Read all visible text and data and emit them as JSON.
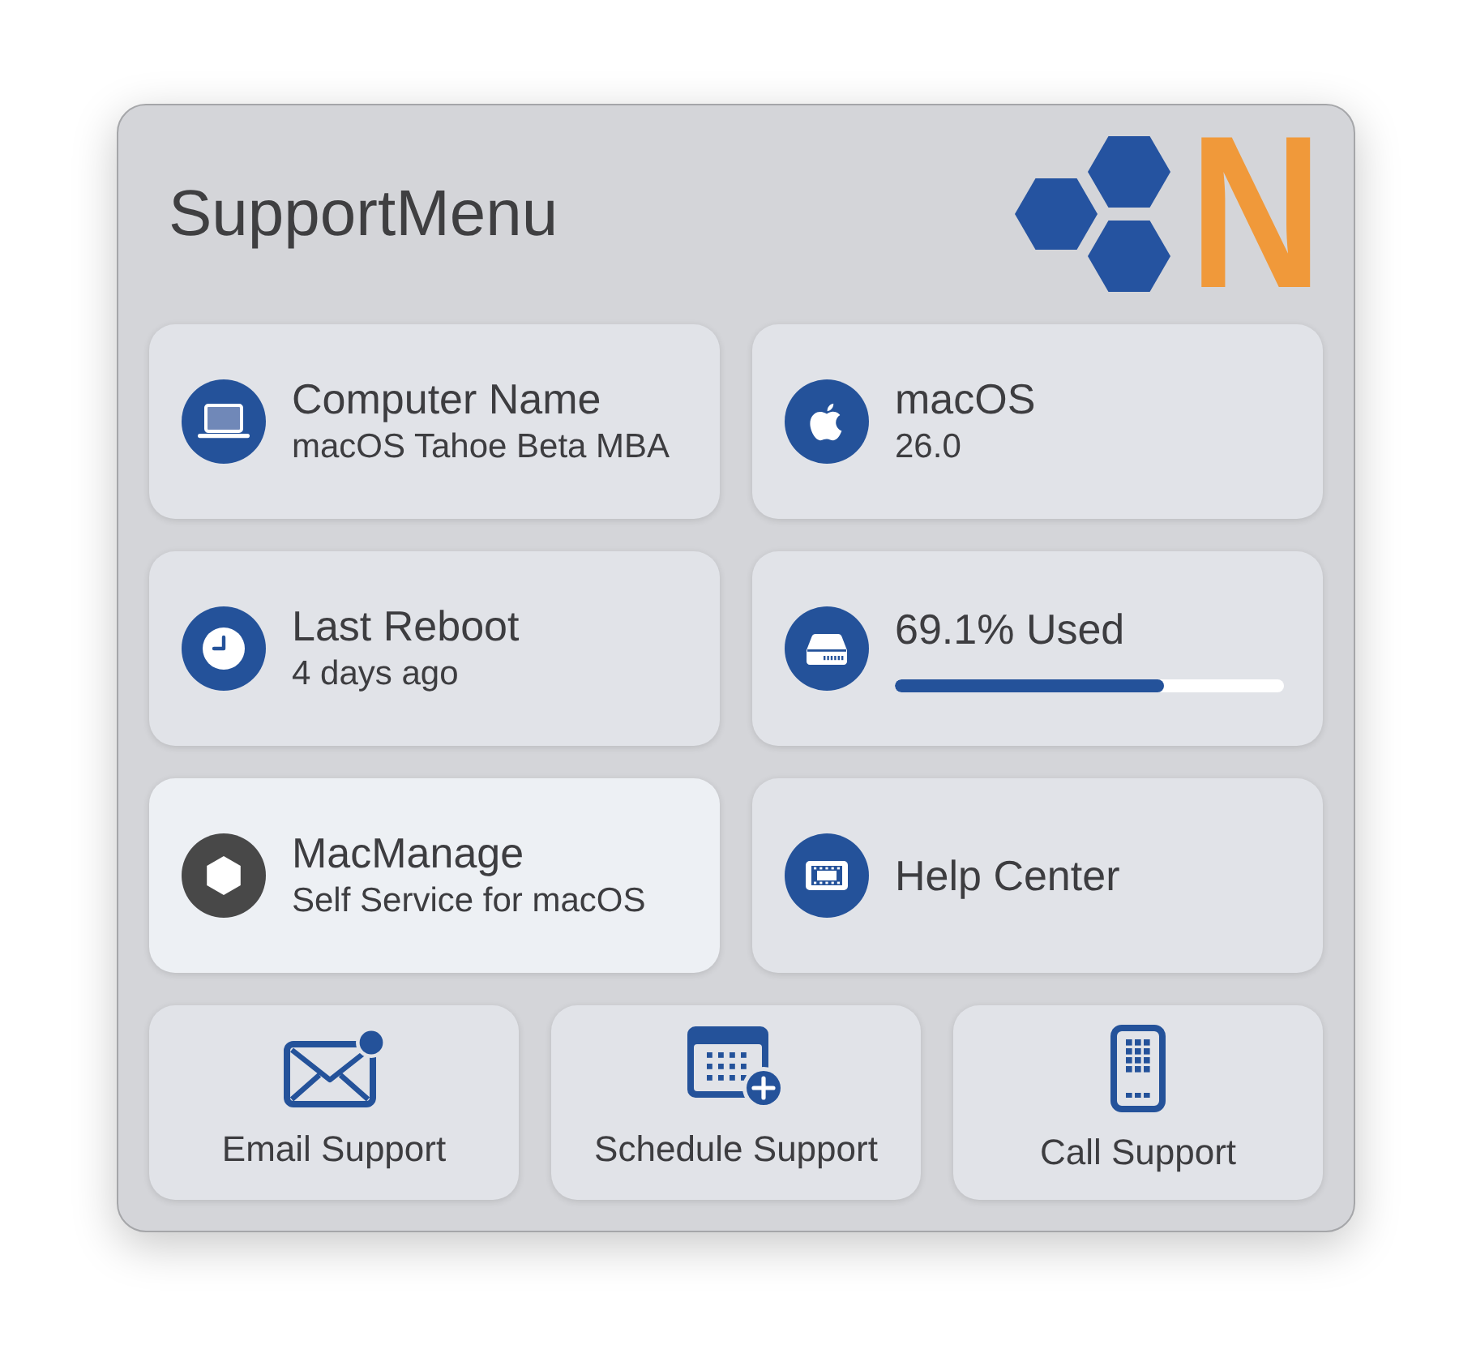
{
  "window": {
    "title": "SupportMenu"
  },
  "logo": {
    "letter": "N"
  },
  "tiles": [
    {
      "kind": "info",
      "title": "Computer Name",
      "subtitle": "macOS Tahoe Beta MBA",
      "highlighted": false
    },
    {
      "kind": "info",
      "title": "macOS",
      "subtitle": "26.0",
      "highlighted": false
    },
    {
      "kind": "info",
      "title": "Last Reboot",
      "subtitle": "4 days ago",
      "highlighted": false
    },
    {
      "kind": "meter",
      "title": "69.1% Used",
      "level": 0.691,
      "highlighted": false
    },
    {
      "kind": "info",
      "title": "MacManage",
      "subtitle": "Self Service for macOS",
      "highlighted": true
    },
    {
      "kind": "info",
      "title": "Help Center",
      "highlighted": false
    }
  ],
  "actions": [
    {
      "label": "Email Support"
    },
    {
      "label": "Schedule Support"
    },
    {
      "label": "Call Support"
    }
  ]
}
